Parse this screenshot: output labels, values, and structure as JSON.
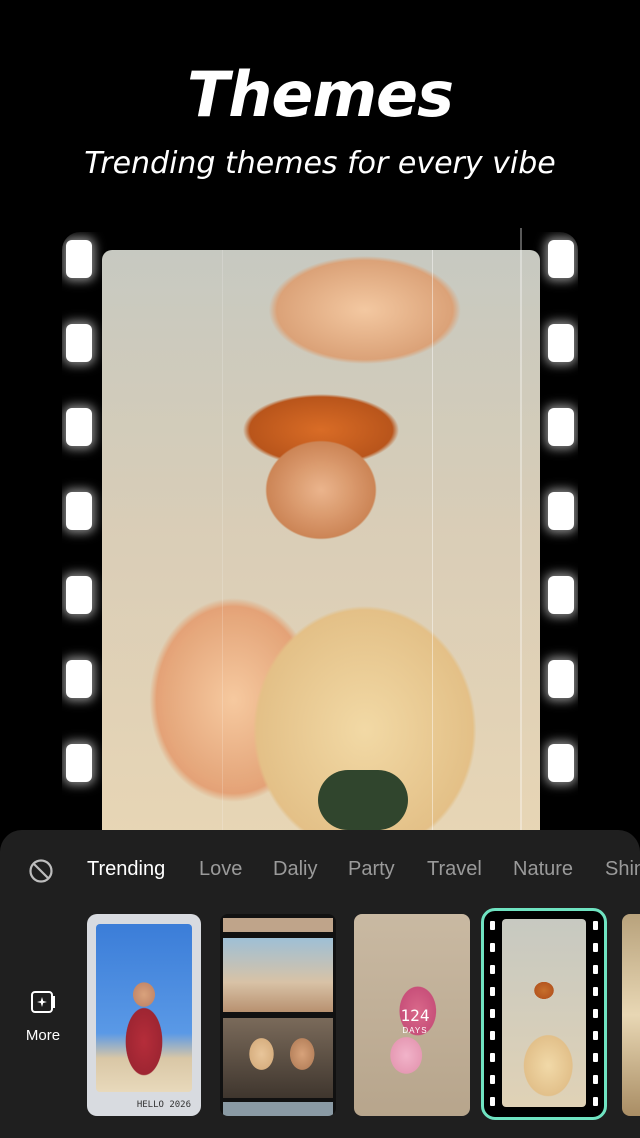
{
  "hero": {
    "title": "Themes",
    "subtitle": "Trending themes for every vibe"
  },
  "tabs": {
    "none_icon": "ban-icon",
    "items": [
      {
        "label": "Trending",
        "active": true
      },
      {
        "label": "Love",
        "active": false
      },
      {
        "label": "Daliy",
        "active": false
      },
      {
        "label": "Party",
        "active": false
      },
      {
        "label": "Travel",
        "active": false
      },
      {
        "label": "Nature",
        "active": false
      },
      {
        "label": "Shin",
        "active": false
      }
    ]
  },
  "more": {
    "icon": "add-frame-icon",
    "label": "More"
  },
  "thumbnails": {
    "t1_caption": "HELLO 2026",
    "t3_count": "124",
    "t3_days": "DAYS"
  },
  "colors": {
    "accent": "#6fe3c1",
    "sheet_bg": "#1f1f1f",
    "tab_inactive": "#9a9a9a"
  }
}
